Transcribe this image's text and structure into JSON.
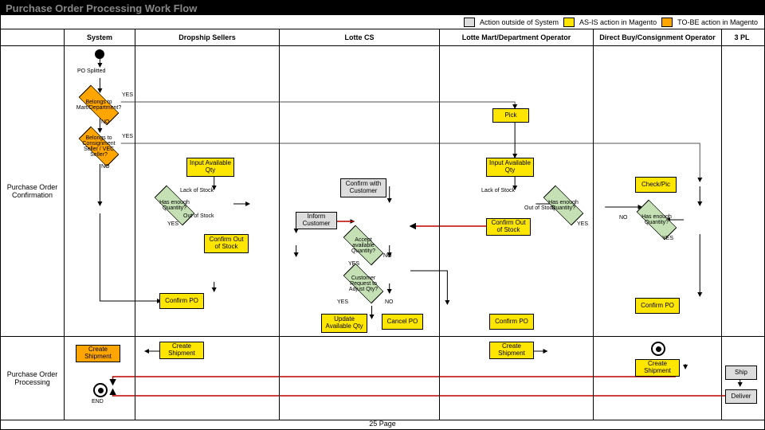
{
  "title": "Purchase Order Processing Work Flow",
  "legend": {
    "a": "Action outside of System",
    "b": "AS-IS action in Magento",
    "c": "TO-BE action in Magento"
  },
  "lanes": {
    "l1": "System",
    "l2": "Dropship Sellers",
    "l3": "Lotte CS",
    "l4": "Lotte Mart/Department Operator",
    "l5": "Direct Buy/Consignment Operator",
    "l6": "3 PL"
  },
  "rows": {
    "r1": "Purchase Order Confirmation",
    "r2": "Purchase Order Processing"
  },
  "nodes": {
    "po_split": "PO Splitted",
    "d_mart": "Belongs to Mart/Department?",
    "d_cons": "Belongs to Consignment Seller / VEC Seller?",
    "yes": "YES",
    "no": "NO",
    "input_qty": "Input Available Qty",
    "lack": "Lack of Stock",
    "out": "Out of Stock",
    "has_enough": "Has enough Quantity?",
    "confirm_out": "Confirm Out of Stock",
    "confirm_cust": "Confirm with Customer",
    "inform": "Inform Customer",
    "accept": "Accept available Quantity?",
    "cust_req": "Customer Request to Adjust Qty?",
    "confirm_po": "Confirm PO",
    "update_qty": "Update Available Qty",
    "cancel_po": "Cancel PO",
    "pick": "Pick",
    "check": "Check/Pic",
    "create_ship": "Create Shipment",
    "ship": "Ship",
    "deliver": "Deliver",
    "end": "END"
  },
  "page": "25 Page"
}
